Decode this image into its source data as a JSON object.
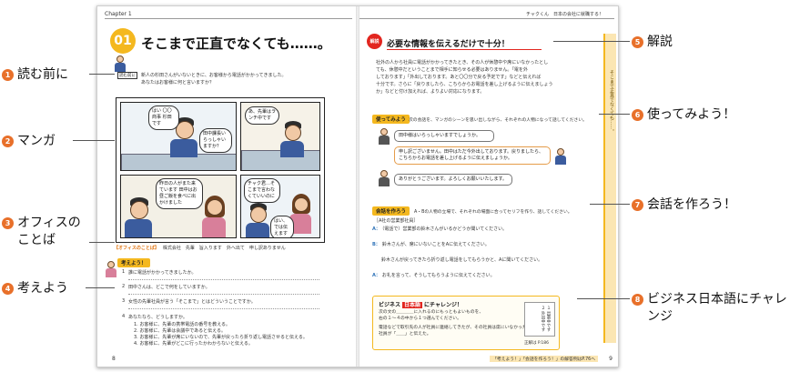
{
  "left_page": {
    "chapter": "Chapter 1",
    "lesson_number": "01",
    "lesson_title": "そこまで正直でなくても……。",
    "read_tag": "読む前に",
    "intro_lines": [
      "新人の杉田さんがいないときに、お客様から電話がかかってきました。",
      "あなたはお客様に何と言いますか？"
    ],
    "manga_bubbles": [
      "はい 〇〇商事 杉田です",
      "田中課長いらっしゃいますか？",
      "あ、先輩はランチ中です",
      "昨日の人がまた来ています 田中はお昼ご飯を食べに出かけました",
      "チャク君…そこまで言わなくていいのに",
      "はい、では伝えます"
    ],
    "office_words_tag": "【オフィスのことば】",
    "office_words": "株式会社　先輩　旨入ります　外へ出て　申し訳ありません",
    "think_tag": "考えよう！",
    "questions": [
      {
        "num": "1",
        "text": "誰に電話がかかってきましたか。"
      },
      {
        "num": "2",
        "text": "田中さんは、どこで何をしていますか。"
      },
      {
        "num": "3",
        "text": "女性の先輩社員が言う「そこまで」とはどういうことですか。"
      },
      {
        "num": "4",
        "text": "あなたなら、どうしますか。"
      }
    ],
    "options": [
      "1. お客様に、先輩の携帯電話の番号を教える。",
      "2. お客様に、先輩は会議中であると伝える。",
      "3. お客様に、先輩が席にいないので、先輩が戻ったら折り返し電話させると伝える。",
      "4. お客様に、先輩がどこに行ったかわからないと伝える。"
    ],
    "page_number": "8"
  },
  "right_page": {
    "header": "チャクくん　日本の会社に就職する！",
    "kaisetsu_badge": "解説",
    "kaisetsu_title": "必要な情報を伝えるだけで十分！",
    "kaisetsu_lines": [
      "社外の人から社員に電話がかかってきたとき、その人が休憩中や席にいなかったとし",
      "ても、休憩中だということまで相手に知らせる必要はありません。「電を外",
      "しております」「外出しております。あと〇〇分で戻る予定です」などと伝えれば",
      "十分です。さらに「戻りましたら、こちらからお電話を差し上げるように伝えましょう",
      "か」などと付け加えれば、よりよい対応になります。"
    ],
    "try_tag": "使ってみよう",
    "try_sub": "次の会話を、マンガのシーンを思い出しながら、それぞれの人物になって話してください。",
    "try_lines": [
      "田中様はいらっしゃいますでしょうか。",
      "申し訳ございません。田中はただ今外出しております。戻りましたら、こちらからお電話を差し上げるように伝えましょうか。",
      "ありがとうございます。よろしくお願いいたします。"
    ],
    "kaiwa_tag": "会話を作ろう",
    "kaiwa_sub": "A・Bの人物の立場で、それぞれの場面に合ってセリフを作り、話してください。",
    "kaiwa_lines": [
      {
        "spk": "",
        "text": "［A社の営業部社員］"
      },
      {
        "spk": "A：",
        "text": "（電話で）営業部の鈴木さんがいるかどうか聞いてください。"
      },
      {
        "spk": "B：",
        "text": "鈴木さんが、席にいないことをAに伝えてください。"
      },
      {
        "spk": "",
        "text": "鈴木さんが戻ってきたら折り返し電話をしてもらうかと、Aに聞いてください。"
      },
      {
        "spk": "A：",
        "text": "お礼を言って、そうしてもらうように伝えてください。"
      }
    ],
    "side_tab": "そこまで正直でなくても……。",
    "challenge_label_1": "ビジネス",
    "challenge_label_2": "日本語",
    "challenge_label_3": "にチャレンジ！",
    "challenge_lines": [
      "次の文の＿＿＿＿に入れるのにもっともよいものを、",
      "右の１〜４の中から１つ選んでください。",
      "電話などで取引先の人が社員に連絡してきたが、その社員は席にいなかった。",
      "社員が「＿＿」と伝えた。"
    ],
    "challenge_choices": "１ 出張中です　２ 外出中です",
    "answer_note": "正解は P.186",
    "footer_note": "「考えよう！」「会話を作ろう！」の解答例はP.76へ",
    "page_number": "9"
  },
  "callouts": [
    {
      "num": "1",
      "label": "読む前に"
    },
    {
      "num": "2",
      "label": "マンガ"
    },
    {
      "num": "3",
      "label": "オフィスのことば"
    },
    {
      "num": "4",
      "label": "考えよう"
    },
    {
      "num": "5",
      "label": "解説"
    },
    {
      "num": "6",
      "label": "使ってみよう！"
    },
    {
      "num": "7",
      "label": "会話を作ろう！"
    },
    {
      "num": "8",
      "label": "ビジネス日本語にチャレンジ"
    }
  ],
  "colors": {
    "callout": "#e8702a",
    "accent_yellow": "#f4b81f",
    "kaisetsu_red": "#e2261f"
  }
}
